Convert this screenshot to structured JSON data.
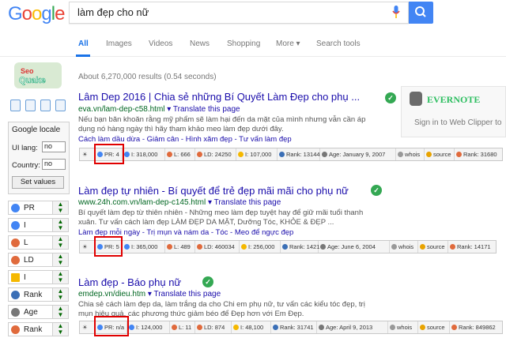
{
  "logo": {
    "letters": [
      "G",
      "o",
      "o",
      "g",
      "l",
      "e"
    ]
  },
  "search": {
    "query": "làm đẹp cho nữ"
  },
  "tabs": [
    "All",
    "Images",
    "Videos",
    "News",
    "Shopping",
    "More ▾",
    "Search tools"
  ],
  "results_info": "About 6,270,000 results (0.54 seconds)",
  "sidebar": {
    "locale_title": "Google locale",
    "ui_lang_label": "UI lang:",
    "ui_lang_value": "no",
    "country_label": "Country:",
    "country_value": "no",
    "set_values": "Set values",
    "params": [
      "PR",
      "I",
      "L",
      "LD",
      "I",
      "Rank",
      "Age",
      "Rank"
    ]
  },
  "evernote": {
    "brand": "EVERNOTE",
    "signin": "Sign in to Web Clipper to"
  },
  "results": [
    {
      "title": "Lâm Dep 2016 | Chia sẻ những Bí Quyết Làm Đẹp cho phụ ...",
      "url": "eva.vn/lam-dep-c58.html",
      "translate": "▾ Translate this page",
      "snip1": "Nếu bạn băn khoăn rằng mỹ phẩm sẽ làm hại đến da mặt của mình nhưng vẫn cần áp",
      "snip2": "dụng nó hàng ngày thì hãy tham khảo meo làm đẹp dưới đây.",
      "links": "Cách làm dầu dừa - Giảm cân - Hình xăm đẹp - Tư vấn làm đẹp",
      "bar": [
        "PR: 4",
        "I: 318,000",
        "L: 666",
        "LD: 24250",
        "I: 107,000",
        "Rank: 13144",
        "Age: January 9, 2007",
        "whois",
        "source",
        "Rank: 31680"
      ]
    },
    {
      "title": "Làm đẹp tự nhiên - Bí quyết để trẻ đẹp mãi mãi cho phụ nữ",
      "url": "www.24h.com.vn/lam-dep-c145.html",
      "translate": "▾ Translate this page",
      "snip1": "Bí quyết làm đẹp từ thiên nhiên - Những meo làm đẹp tuyệt hay để giữ mãi tuổi thanh",
      "snip2": "xuân. Tư vấn cách làm đẹp LÀM ĐẸP DA MẶT, Dưỡng Tóc, KHỎE & ĐẸP ...",
      "links": "Làm đẹp mỗi ngày - Trị mụn và nám da - Tóc - Meo để ngực đẹp",
      "bar": [
        "PR: 5",
        "I: 365,000",
        "L: 489",
        "LD: 460034",
        "I: 256,000",
        "Rank: 1421",
        "Age: June 6, 2004",
        "whois",
        "source",
        "Rank: 14171"
      ]
    },
    {
      "title": "Làm đẹp - Báo phụ nữ",
      "url": "emdep.vn/dieu.htm",
      "translate": "▾ Translate this page",
      "snip1": "Chia sẻ cách làm đẹp da, làm trắng da cho Chi em phụ nữ, tư vấn các kiểu tóc đẹp, trị",
      "snip2": "mụn hiệu quả, các phương thức giảm béo để Đẹp hơn với Em Đẹp.",
      "links": "",
      "bar": [
        "PR: n/a",
        "I: 124,000",
        "L: 11",
        "LD: 874",
        "I: 48,100",
        "Rank: 31741",
        "Age: April 9, 2013",
        "whois",
        "source",
        "Rank: 849862"
      ]
    }
  ]
}
